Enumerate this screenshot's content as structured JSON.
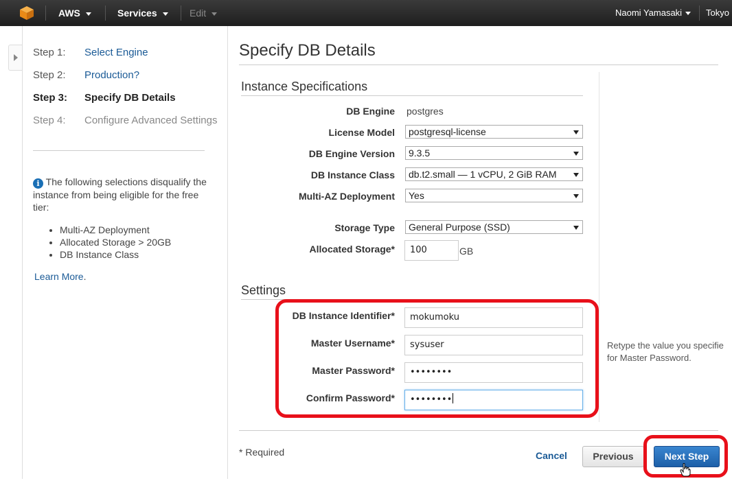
{
  "nav": {
    "brand": "AWS",
    "services": "Services",
    "edit": "Edit",
    "user": "Naomi Yamasaki",
    "region": "Tokyo",
    "colors": {
      "bar": "#232f3e",
      "logo": "#f7981d"
    }
  },
  "steps": [
    {
      "num": "Step 1:",
      "label": "Select Engine"
    },
    {
      "num": "Step 2:",
      "label": "Production?"
    },
    {
      "num": "Step 3:",
      "label": "Specify DB Details"
    },
    {
      "num": "Step 4:",
      "label": "Configure Advanced Settings"
    }
  ],
  "info": {
    "icon": "info-icon",
    "text": "The following selections disqualify the instance from being eligible for the free tier:",
    "items": [
      "Multi-AZ Deployment",
      "Allocated Storage > 20GB",
      "DB Instance Class"
    ],
    "learn_more": "Learn More",
    "learn_more_suffix": "."
  },
  "page_title": "Specify DB Details",
  "instance_specs": {
    "heading": "Instance Specifications",
    "db_engine_label": "DB Engine",
    "db_engine_value": "postgres",
    "license_label": "License Model",
    "license_value": "postgresql-license",
    "version_label": "DB Engine Version",
    "version_value": "9.3.5",
    "class_label": "DB Instance Class",
    "class_value": "db.t2.small — 1 vCPU, 2 GiB RAM",
    "multiaz_label": "Multi-AZ Deployment",
    "multiaz_value": "Yes",
    "storage_type_label": "Storage Type",
    "storage_type_value": "General Purpose (SSD)",
    "allocated_label": "Allocated Storage*",
    "allocated_value": "100",
    "allocated_unit": "GB"
  },
  "settings": {
    "heading": "Settings",
    "identifier_label": "DB Instance Identifier*",
    "identifier_value": "mokumoku",
    "username_label": "Master Username*",
    "username_value": "sysuser",
    "password_label": "Master Password*",
    "password_value": "••••••••",
    "confirm_label": "Confirm Password*",
    "confirm_value": "••••••••",
    "help_line1": "Retype the value you specifie",
    "help_line2": "for Master Password."
  },
  "footer": {
    "required": "* Required",
    "cancel": "Cancel",
    "previous": "Previous",
    "next": "Next Step"
  }
}
